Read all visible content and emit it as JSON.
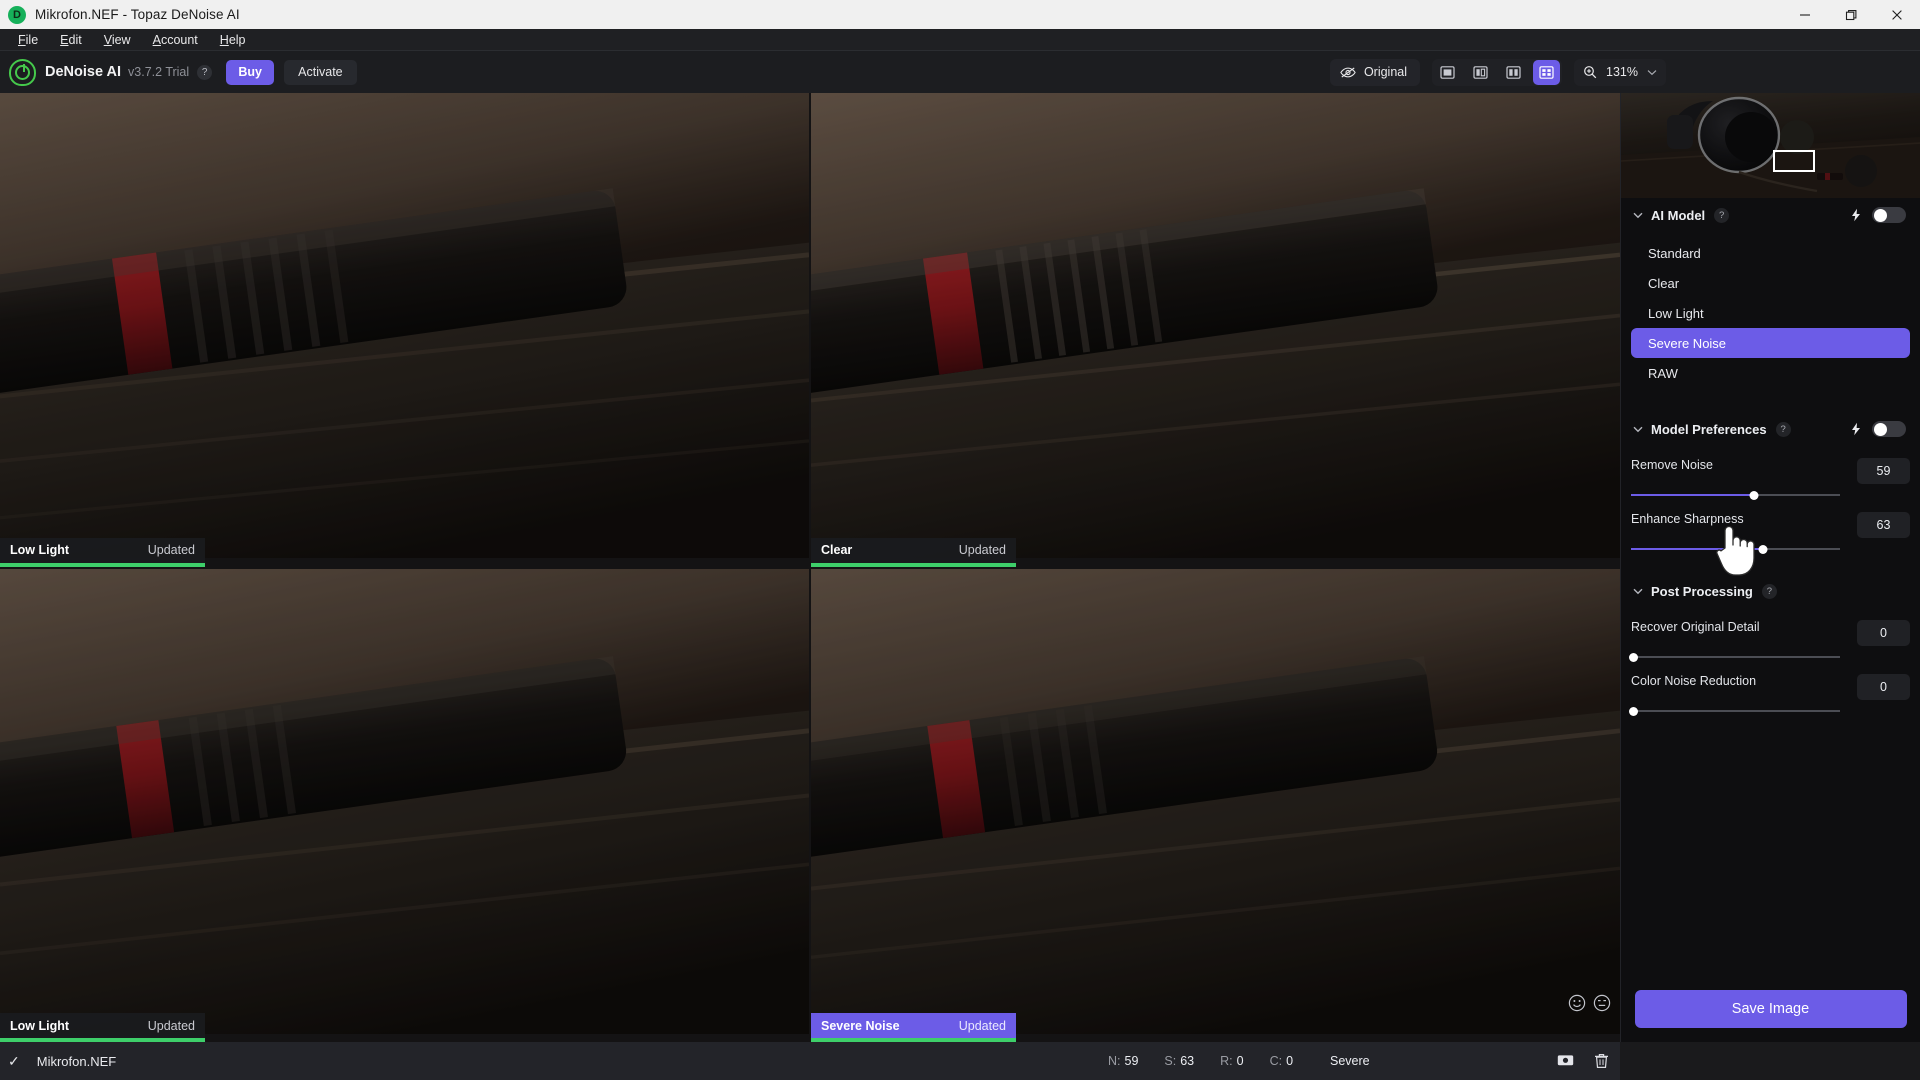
{
  "window": {
    "title": "Mikrofon.NEF - Topaz DeNoise AI",
    "app_icon": "denoise-logo-icon",
    "controls": {
      "minimize": "minimize-icon",
      "maximize": "maximize-icon",
      "close": "close-icon"
    }
  },
  "menubar": {
    "items": [
      "File",
      "Edit",
      "View",
      "Account",
      "Help"
    ]
  },
  "toolbar": {
    "brand_name": "DeNoise AI",
    "version": "v3.7.2 Trial",
    "help_label": "?",
    "buy_label": "Buy",
    "activate_label": "Activate",
    "original_label": "Original",
    "original_icon": "eye-off-icon",
    "view_modes": [
      {
        "name": "single-view",
        "icon": "square-icon",
        "active": false
      },
      {
        "name": "split-view",
        "icon": "split-vertical-icon",
        "active": false
      },
      {
        "name": "side-by-side-view",
        "icon": "two-columns-icon",
        "active": false
      },
      {
        "name": "quad-view",
        "icon": "grid-four-icon",
        "active": true
      }
    ],
    "zoom_icon": "magnifier-plus-icon",
    "zoom_level": "131%",
    "zoom_chevron": "chevron-down-icon"
  },
  "canvas": {
    "panes": [
      {
        "name": "Low Light",
        "status": "Updated",
        "selected": false
      },
      {
        "name": "Clear",
        "status": "Updated",
        "selected": false
      },
      {
        "name": "Low Light",
        "status": "Updated",
        "selected": false
      },
      {
        "name": "Severe Noise",
        "status": "Updated",
        "selected": true
      }
    ],
    "feedback_icons": [
      "smiley-happy-icon",
      "smiley-neutral-icon"
    ]
  },
  "right_panel": {
    "navigator": {
      "name": "navigator-thumbnail",
      "viewport_rect": "viewport-rect"
    },
    "ai_model": {
      "title": "AI Model",
      "help_label": "?",
      "auto_icon": "lightning-bolt-icon",
      "toggle_on": true,
      "options": [
        "Standard",
        "Clear",
        "Low Light",
        "Severe Noise",
        "RAW"
      ],
      "selected": "Severe Noise"
    },
    "model_preferences": {
      "title": "Model Preferences",
      "help_label": "?",
      "auto_icon": "lightning-bolt-icon",
      "toggle_on": true,
      "sliders": [
        {
          "label": "Remove Noise",
          "value": "59",
          "percent": 59
        },
        {
          "label": "Enhance Sharpness",
          "value": "63",
          "percent": 63
        }
      ]
    },
    "post_processing": {
      "title": "Post Processing",
      "help_label": "?",
      "sliders": [
        {
          "label": "Recover Original Detail",
          "value": "0",
          "percent": 0
        },
        {
          "label": "Color Noise Reduction",
          "value": "0",
          "percent": 0
        }
      ]
    },
    "save_label": "Save Image"
  },
  "statusbar": {
    "check_icon": "checkmark-icon",
    "filename": "Mikrofon.NEF",
    "stats": [
      {
        "key": "N:",
        "value": "59"
      },
      {
        "key": "S:",
        "value": "63"
      },
      {
        "key": "R:",
        "value": "0"
      },
      {
        "key": "C:",
        "value": "0"
      }
    ],
    "mode": "Severe",
    "icons": [
      "export-image-icon",
      "trash-icon"
    ]
  },
  "colors": {
    "accent": "#6c5ce7",
    "updated_bar": "#3ecf6a",
    "panel_bg": "#0e0e10",
    "titlebar_bg": "#f0f0f0"
  }
}
